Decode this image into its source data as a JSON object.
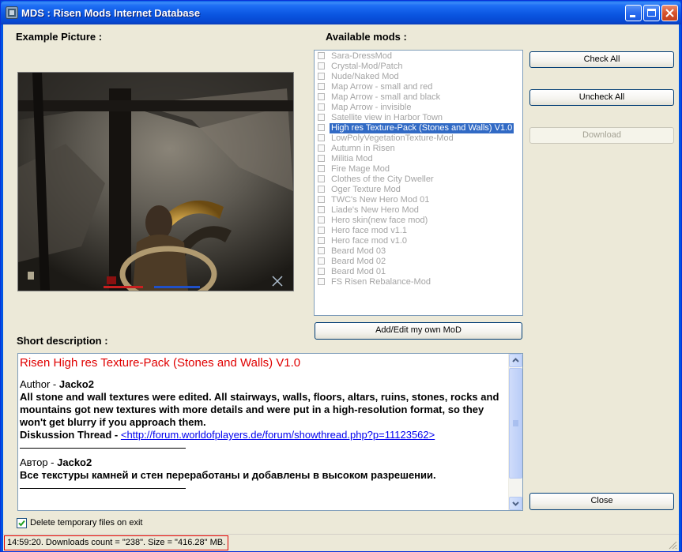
{
  "window": {
    "title": "MDS : Risen Mods Internet Database"
  },
  "labels": {
    "example_picture": "Example Picture :",
    "available_mods": "Available mods :",
    "short_description": "Short description :"
  },
  "mods": [
    {
      "label": "Sara-DressMod",
      "checked": false,
      "selected": false
    },
    {
      "label": "Crystal-Mod/Patch",
      "checked": false,
      "selected": false
    },
    {
      "label": "Nude/Naked Mod",
      "checked": false,
      "selected": false
    },
    {
      "label": "Map Arrow - small and red",
      "checked": false,
      "selected": false
    },
    {
      "label": "Map Arrow - small and black",
      "checked": false,
      "selected": false
    },
    {
      "label": "Map Arrow - invisible",
      "checked": false,
      "selected": false
    },
    {
      "label": "Satellite view in Harbor Town",
      "checked": false,
      "selected": false
    },
    {
      "label": "High res Texture-Pack (Stones and Walls) V1.0",
      "checked": false,
      "selected": true
    },
    {
      "label": "LowPolyVegetationTexture-Mod",
      "checked": false,
      "selected": false
    },
    {
      "label": "Autumn in Risen",
      "checked": false,
      "selected": false
    },
    {
      "label": "Militia Mod",
      "checked": false,
      "selected": false
    },
    {
      "label": "Fire Mage Mod",
      "checked": false,
      "selected": false
    },
    {
      "label": "Clothes of the City Dweller",
      "checked": false,
      "selected": false
    },
    {
      "label": "Oger Texture Mod",
      "checked": false,
      "selected": false
    },
    {
      "label": "TWC's New Hero Mod 01",
      "checked": false,
      "selected": false
    },
    {
      "label": "Liade's New Hero Mod",
      "checked": false,
      "selected": false
    },
    {
      "label": "Hero skin(new face mod)",
      "checked": false,
      "selected": false
    },
    {
      "label": "Hero face mod v1.1",
      "checked": false,
      "selected": false
    },
    {
      "label": "Hero face mod v1.0",
      "checked": false,
      "selected": false
    },
    {
      "label": "Beard Mod 03",
      "checked": false,
      "selected": false
    },
    {
      "label": "Beard Mod 02",
      "checked": false,
      "selected": false
    },
    {
      "label": "Beard Mod 01",
      "checked": false,
      "selected": false
    },
    {
      "label": "FS Risen Rebalance-Mod",
      "checked": false,
      "selected": false
    }
  ],
  "buttons": {
    "check_all": "Check All",
    "uncheck_all": "Uncheck All",
    "download": "Download",
    "add_edit": "Add/Edit my own MoD",
    "close": "Close"
  },
  "description": {
    "title": "Risen High res Texture-Pack (Stones and Walls) V1.0",
    "author_label_en": "Author - ",
    "author_name_en": "Jacko2",
    "body_en": "All stone and wall textures were edited. All stairways, walls, floors, altars, ruins, stones, rocks and mountains got new textures with more details and were put in a high-resolution format, so they won't get blurry if you approach them.",
    "thread_label": "Diskussion Thread - ",
    "thread_link": "<http://forum.worldofplayers.de/forum/showthread.php?p=11123562>",
    "author_label_ru": "Автор - ",
    "author_name_ru": "Jacko2",
    "body_ru": "Все текстуры камней и стен переработаны и добавлены в высоком разрешении."
  },
  "options": {
    "delete_temp_label": "Delete temporary files on exit",
    "delete_temp_checked": true
  },
  "status": {
    "text": "14:59:20. Downloads count = \"238\". Size = \"416.28\" MB."
  },
  "colors": {
    "title_text_red": "#e00000",
    "selection": "#316ac5",
    "dialog_bg": "#ece9d8",
    "titlebar_blue": "#0a55e0"
  }
}
